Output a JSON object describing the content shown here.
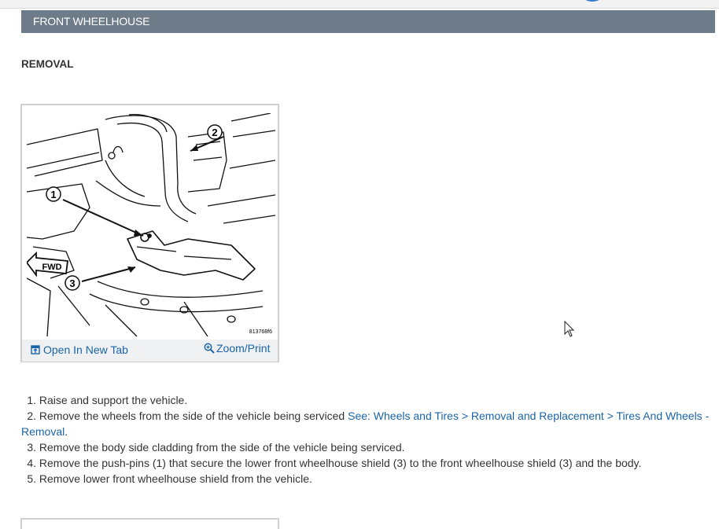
{
  "section": {
    "title": "FRONT WHEELHOUSE",
    "subheading": "REMOVAL"
  },
  "figure": {
    "image_code": "813768f6",
    "callouts": [
      "1",
      "2",
      "3"
    ],
    "fwd_label": "FWD",
    "open_new_tab_label": "Open In New Tab",
    "zoom_print_label": "Zoom/Print",
    "open_new_tab_icon": "open-new-tab-icon",
    "zoom_icon": "zoom-in-icon"
  },
  "steps": [
    {
      "num": "1.",
      "text": "Raise and support the vehicle."
    },
    {
      "num": "2.",
      "text": "Remove the wheels from the side of the vehicle being serviced ",
      "link": "See: Wheels and Tires > Removal and Replacement > Tires And Wheels - Removal",
      "after": "."
    },
    {
      "num": "3.",
      "text": "Remove the body side cladding from the side of the vehicle being serviced."
    },
    {
      "num": "4.",
      "text": "Remove the push-pins (1) that secure the lower front wheelhouse shield (3) to the front wheelhouse shield (3) and the body."
    },
    {
      "num": "5.",
      "text": "Remove lower front wheelhouse shield from the vehicle."
    }
  ],
  "colors": {
    "header_bg": "#6e7b89",
    "link": "#1a64a8",
    "text": "#333333"
  }
}
